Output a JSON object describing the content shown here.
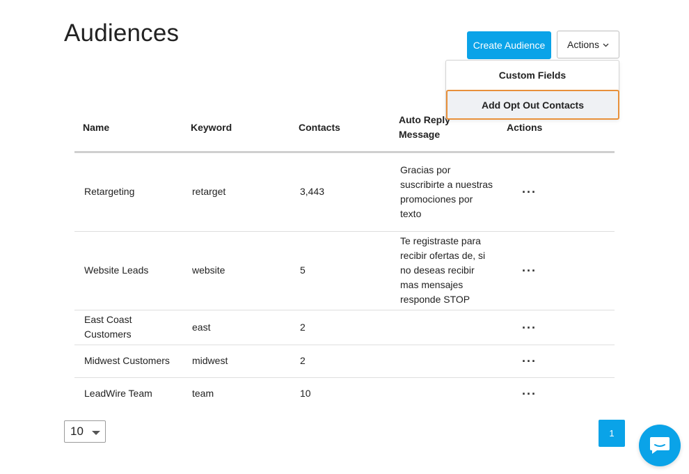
{
  "page": {
    "title": "Audiences"
  },
  "toolbar": {
    "create_label": "Create Audience",
    "actions_label": "Actions"
  },
  "actions_menu": {
    "items": [
      {
        "label": "Custom Fields"
      },
      {
        "label": "Add Opt Out Contacts"
      }
    ]
  },
  "table": {
    "headers": {
      "name": "Name",
      "keyword": "Keyword",
      "contacts": "Contacts",
      "auto_reply": "Auto Reply Message",
      "actions": "Actions"
    },
    "rows": [
      {
        "name": "Retargeting",
        "keyword": "retarget",
        "contacts": "3,443",
        "auto_reply": "Gracias por suscribirte a nuestras promociones por texto",
        "menu": "..."
      },
      {
        "name": "Website Leads",
        "keyword": "website",
        "contacts": "5",
        "auto_reply": "Te registraste para recibir ofertas de, si no deseas recibir mas mensajes responde STOP",
        "menu": "..."
      },
      {
        "name": "East Coast Customers",
        "keyword": "east",
        "contacts": "2",
        "auto_reply": "",
        "menu": "..."
      },
      {
        "name": "Midwest Customers",
        "keyword": "midwest",
        "contacts": "2",
        "auto_reply": "",
        "menu": "..."
      },
      {
        "name": "LeadWire Team",
        "keyword": "team",
        "contacts": "10",
        "auto_reply": "",
        "menu": "..."
      }
    ]
  },
  "pagination": {
    "per_page": "10",
    "current_page": "1"
  },
  "colors": {
    "accent": "#0aa3e8",
    "focus_outline": "#e8903a"
  },
  "icons": {
    "actions_caret": "chevron-down-icon",
    "row_menu": "ellipsis-icon",
    "chat": "chat-bubble-icon"
  }
}
